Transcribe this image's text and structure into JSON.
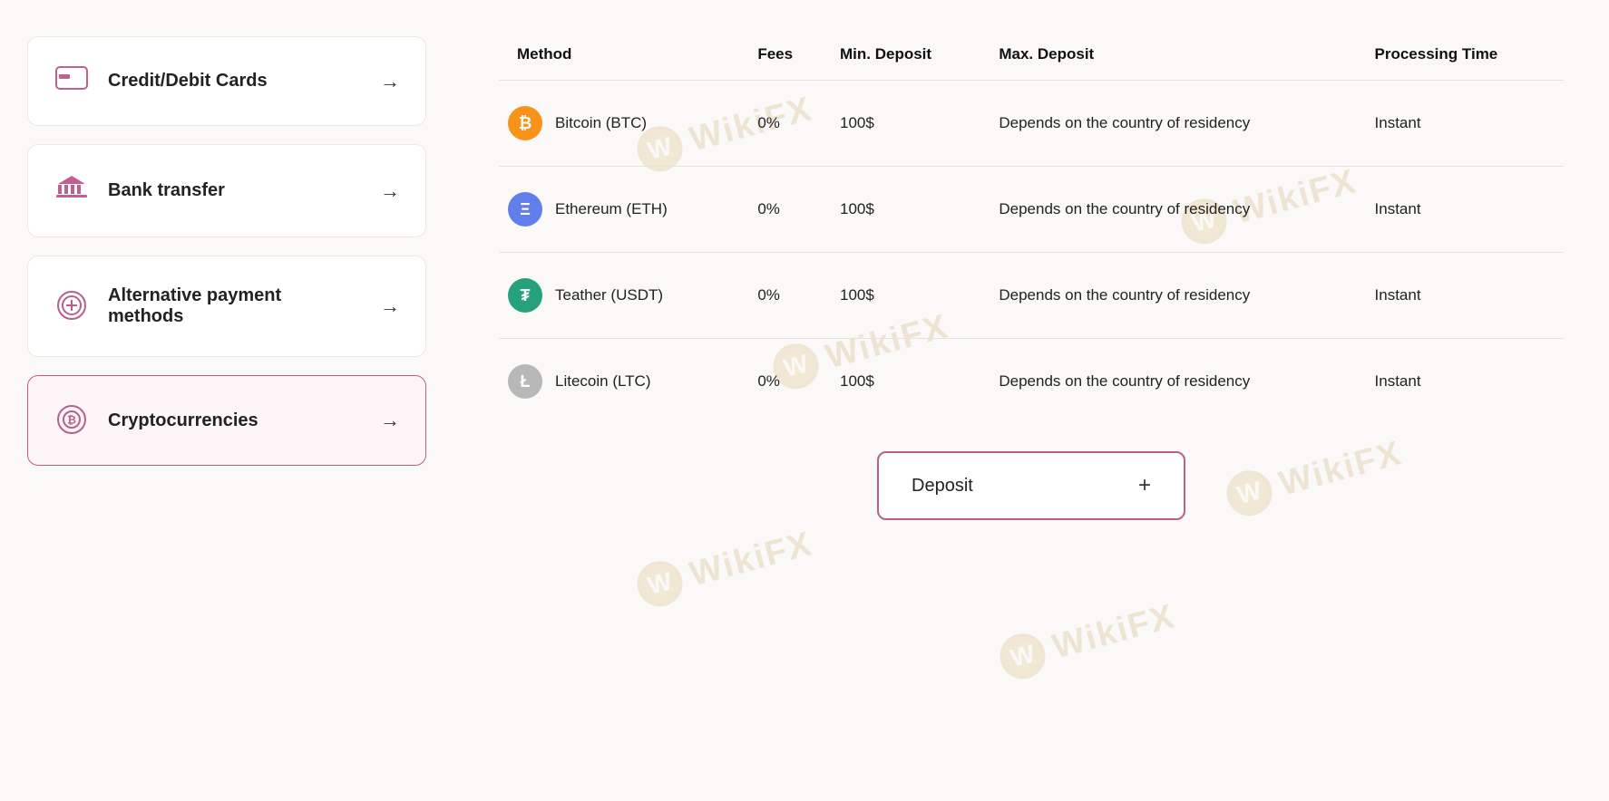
{
  "left_panel": {
    "items": [
      {
        "id": "credit-debit",
        "label": "Credit/Debit Cards",
        "icon_type": "card",
        "active": false
      },
      {
        "id": "bank-transfer",
        "label": "Bank transfer",
        "icon_type": "bank",
        "active": false
      },
      {
        "id": "alternative",
        "label": "Alternative payment methods",
        "icon_type": "alt",
        "active": false
      },
      {
        "id": "crypto",
        "label": "Cryptocurrencies",
        "icon_type": "crypto",
        "active": true
      }
    ],
    "arrow": "→"
  },
  "right_panel": {
    "table": {
      "headers": [
        "Method",
        "Fees",
        "Min. Deposit",
        "Max. Deposit",
        "Processing Time"
      ],
      "rows": [
        {
          "coin": "btc",
          "coin_symbol": "₿",
          "method": "Bitcoin (BTC)",
          "fees": "0%",
          "min_deposit": "100$",
          "max_deposit": "Depends on the country of residency",
          "processing_time": "Instant"
        },
        {
          "coin": "eth",
          "coin_symbol": "◈",
          "method": "Ethereum (ETH)",
          "fees": "0%",
          "min_deposit": "100$",
          "max_deposit": "Depends on the country of residency",
          "processing_time": "Instant"
        },
        {
          "coin": "usdt",
          "coin_symbol": "₮",
          "method": "Teather (USDT)",
          "fees": "0%",
          "min_deposit": "100$",
          "max_deposit": "Depends on the country of residency",
          "processing_time": "Instant"
        },
        {
          "coin": "ltc",
          "coin_symbol": "Ł",
          "method": "Litecoin (LTC)",
          "fees": "0%",
          "min_deposit": "100$",
          "max_deposit": "Depends on the country of residency",
          "processing_time": "Instant"
        }
      ]
    },
    "deposit_button": {
      "label": "Deposit",
      "plus": "+"
    }
  }
}
